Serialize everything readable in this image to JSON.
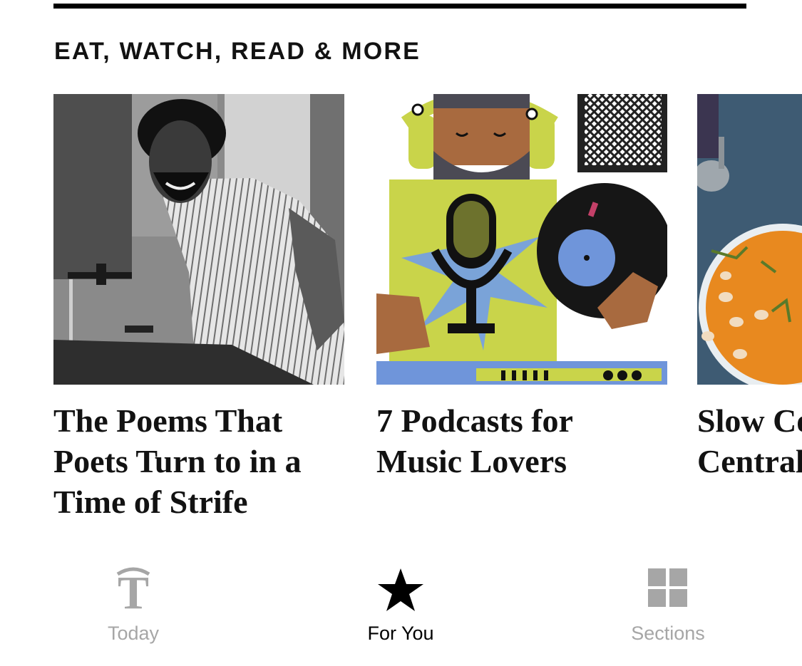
{
  "section": {
    "heading": "EAT, WATCH, READ & MORE"
  },
  "cards": [
    {
      "headline": "The Poems That Poets Turn to in a Time of Strife",
      "image": "poet-at-podium-photo"
    },
    {
      "headline": "7 Podcasts for Music Lovers",
      "image": "podcast-dj-illustration"
    },
    {
      "headline": "Slow Cooker Central",
      "image": "soup-bowl-photo"
    }
  ],
  "tabbar": {
    "tabs": [
      {
        "label": "Today",
        "icon": "nyt-logo-icon",
        "active": false
      },
      {
        "label": "For You",
        "icon": "star-icon",
        "active": true
      },
      {
        "label": "Sections",
        "icon": "grid-icon",
        "active": false
      }
    ],
    "active_color": "#000000",
    "inactive_color": "#a6a6a6"
  }
}
